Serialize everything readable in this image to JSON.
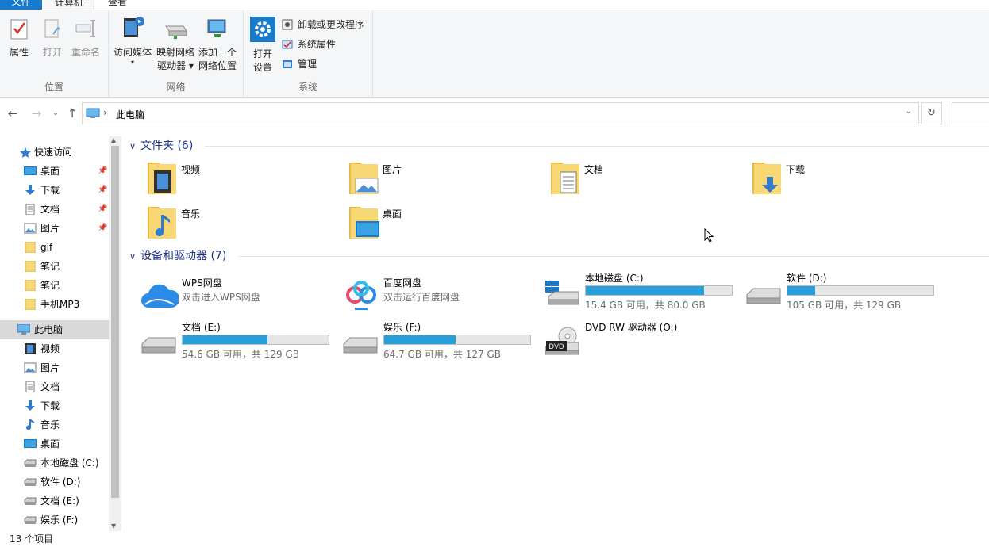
{
  "ribbon": {
    "tabs": {
      "file": "文件",
      "computer": "计算机",
      "view": "查看"
    },
    "location": {
      "label": "位置",
      "properties": "属性",
      "open": "打开",
      "rename": "重命名"
    },
    "network": {
      "label": "网络",
      "access_media": "访问媒体",
      "map_drive_1": "映射网络",
      "map_drive_2": "驱动器",
      "add_location_1": "添加一个",
      "add_location_2": "网络位置"
    },
    "system": {
      "label": "系统",
      "open_settings_1": "打开",
      "open_settings_2": "设置",
      "uninstall": "卸载或更改程序",
      "system_properties": "系统属性",
      "manage": "管理"
    }
  },
  "address": {
    "path": "此电脑"
  },
  "sidebar": {
    "quick_access": "快速访问",
    "items": [
      "桌面",
      "下载",
      "文档",
      "图片",
      "gif",
      "笔记",
      "笔记",
      "手机MP3"
    ],
    "this_pc": "此电脑",
    "pc_items": [
      "视频",
      "图片",
      "文档",
      "下载",
      "音乐",
      "桌面",
      "本地磁盘 (C:)",
      "软件 (D:)",
      "文档 (E:)",
      "娱乐 (F:)"
    ]
  },
  "status": {
    "count": "13 个项目"
  },
  "folders": {
    "header": "文件夹 (6)",
    "items": [
      "视频",
      "图片",
      "文档",
      "下载",
      "音乐",
      "桌面"
    ]
  },
  "devices": {
    "header": "设备和驱动器 (7)",
    "wps": {
      "name": "WPS网盘",
      "sub": "双击进入WPS网盘"
    },
    "baidu": {
      "name": "百度网盘",
      "sub": "双击运行百度网盘"
    },
    "c": {
      "name": "本地磁盘 (C:)",
      "info": "15.4 GB 可用，共 80.0 GB",
      "used_fraction": 0.81
    },
    "d": {
      "name": "软件 (D:)",
      "info": "105 GB 可用，共 129 GB",
      "used_fraction": 0.19
    },
    "e": {
      "name": "文档 (E:)",
      "info": "54.6 GB 可用，共 129 GB",
      "used_fraction": 0.58
    },
    "f": {
      "name": "娱乐 (F:)",
      "info": "64.7 GB 可用，共 127 GB",
      "used_fraction": 0.49
    },
    "dvd": {
      "name": "DVD RW 驱动器 (O:)",
      "badge": "DVD"
    }
  },
  "colors": {
    "accent": "#1979ca",
    "bar": "#26a0da",
    "folder": "#f8d775",
    "heading": "#1e3287"
  }
}
